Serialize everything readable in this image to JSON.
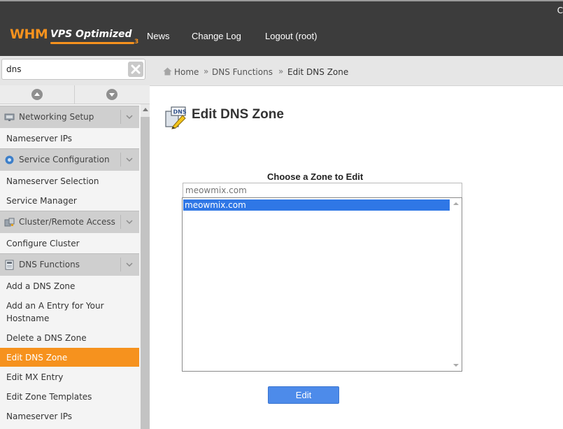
{
  "header": {
    "logo_main": "WHM",
    "logo_sub": "VPS Optimized",
    "logo_version": "3",
    "corner_text": "C",
    "nav": [
      "News",
      "Change Log",
      "Logout (root)"
    ]
  },
  "search": {
    "value": "dns"
  },
  "sidebar": {
    "sections": [
      {
        "title": "Networking Setup",
        "icon": "network-icon",
        "items": [
          "Nameserver IPs"
        ]
      },
      {
        "title": "Service Configuration",
        "icon": "gear-icon",
        "items": [
          "Nameserver Selection",
          "Service Manager"
        ]
      },
      {
        "title": "Cluster/Remote Access",
        "icon": "cluster-icon",
        "items": [
          "Configure Cluster"
        ]
      },
      {
        "title": "DNS Functions",
        "icon": "dns-icon",
        "items": [
          "Add a DNS Zone",
          "Add an A Entry for Your",
          "Hostname",
          "Delete a DNS Zone",
          "Edit DNS Zone",
          "Edit MX Entry",
          "Edit Zone Templates",
          "Nameserver IPs"
        ]
      }
    ],
    "active_item": "Edit DNS Zone"
  },
  "breadcrumb": {
    "home": "Home",
    "separator": "»",
    "section": "DNS Functions",
    "current": "Edit DNS Zone"
  },
  "page": {
    "title": "Edit DNS Zone",
    "icon": "dns-pencil-icon",
    "choose_label": "Choose a Zone to Edit",
    "filter_placeholder": "meowmix.com",
    "zones": [
      "meowmix.com"
    ],
    "selected_zone": "meowmix.com",
    "edit_button": "Edit"
  },
  "colors": {
    "accent_orange": "#f6921e",
    "topbar": "#3c3c3c",
    "selection_blue": "#2f77e6",
    "button_blue": "#4d8bea"
  }
}
